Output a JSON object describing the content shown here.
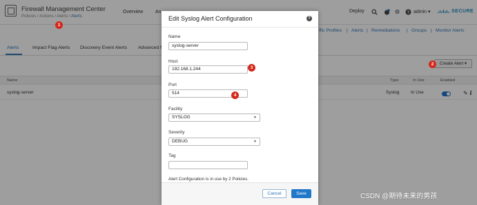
{
  "app": {
    "title": "Firewall Management Center",
    "breadcrumb_prefix": "Policies / Actions / Alerts / ",
    "breadcrumb_current": "Alerts"
  },
  "top_nav": [
    "Overview",
    "An"
  ],
  "top_right": {
    "deploy_label": "Deploy",
    "user_label": "admin",
    "brand_label": "SECURE"
  },
  "sub_nav": [
    "ffic Profiles",
    "Alerts",
    "Remediations",
    "Groups",
    "Monitor Alerts"
  ],
  "tabs": [
    "Alerts",
    "Impact Flag Alerts",
    "Discovery Event Alerts",
    "Advanced M"
  ],
  "create_button_label": "Create Alert",
  "table": {
    "headers": {
      "name": "Name",
      "type": "Type",
      "in_use": "In Use",
      "enabled": "Enabled"
    },
    "rows": [
      {
        "name": "syslog-server",
        "type": "Syslog",
        "in_use": "In Use",
        "enabled": true
      }
    ]
  },
  "modal": {
    "title": "Edit Syslog Alert Configuration",
    "name_label": "Name",
    "name_value": "syslog-server",
    "host_label": "Host",
    "host_value": "192.168.1.244",
    "port_label": "Port",
    "port_value": "514",
    "facility_label": "Facility",
    "facility_value": "SYSLOG",
    "severity_label": "Severity",
    "severity_value": "DEBUG",
    "tag_label": "Tag",
    "tag_value": "",
    "usage_note": "Alert Configuration is in use by 2 Policies.",
    "cancel_label": "Cancel",
    "save_label": "Save"
  },
  "badges": [
    "1",
    "2",
    "3",
    "4"
  ],
  "watermark": "CSDN @期待未来的男孩",
  "colors": {
    "accent": "#1f78c8",
    "badge": "#d4271c",
    "link": "#2f74b5"
  },
  "icons": [
    "app-logo-icon",
    "search-icon",
    "notifications-icon",
    "settings-gear-icon",
    "help-icon",
    "chevron-down-icon",
    "edit-pencil-icon",
    "info-icon"
  ]
}
